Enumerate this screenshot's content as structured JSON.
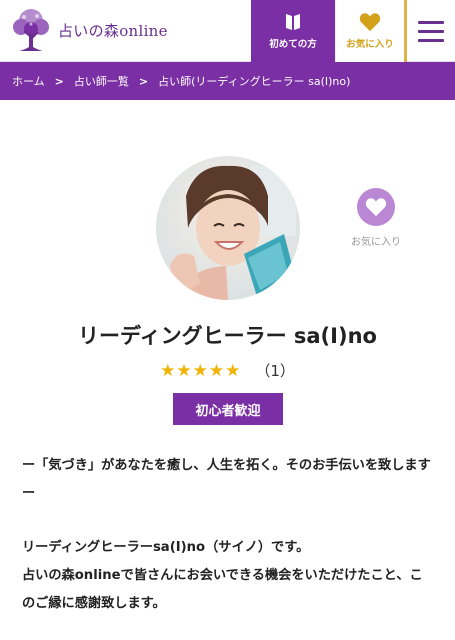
{
  "header": {
    "logo_text": "占いの森online",
    "first_time_label": "初めての方",
    "favorites_label": "お気に入り",
    "menu_icon": "hamburger-icon"
  },
  "breadcrumb": {
    "items": [
      "ホーム",
      "占い師一覧",
      "占い師(リーディングヒーラー sa(I)no)"
    ],
    "separator": ">"
  },
  "profile": {
    "name": "リーディングヒーラー sa(I)no",
    "stars": "★★★★★",
    "rating_count": "（1）",
    "badge": "初心者歓迎",
    "favorite_label": "お気に入り"
  },
  "intro": {
    "lines": [
      "ー「気づき」があなたを癒し、人生を拓く。そのお手伝いを致しますー",
      "リーディングヒーラーsa(I)no（サイノ）です。",
      "占いの森onlineで皆さんにお会いできる機会をいただけたこと、このご縁に感謝致します。"
    ]
  },
  "colors": {
    "brand_purple": "#7b2fa4",
    "gold": "#e0b24a",
    "star": "#f0b400",
    "fav_circle": "#b987d3"
  }
}
